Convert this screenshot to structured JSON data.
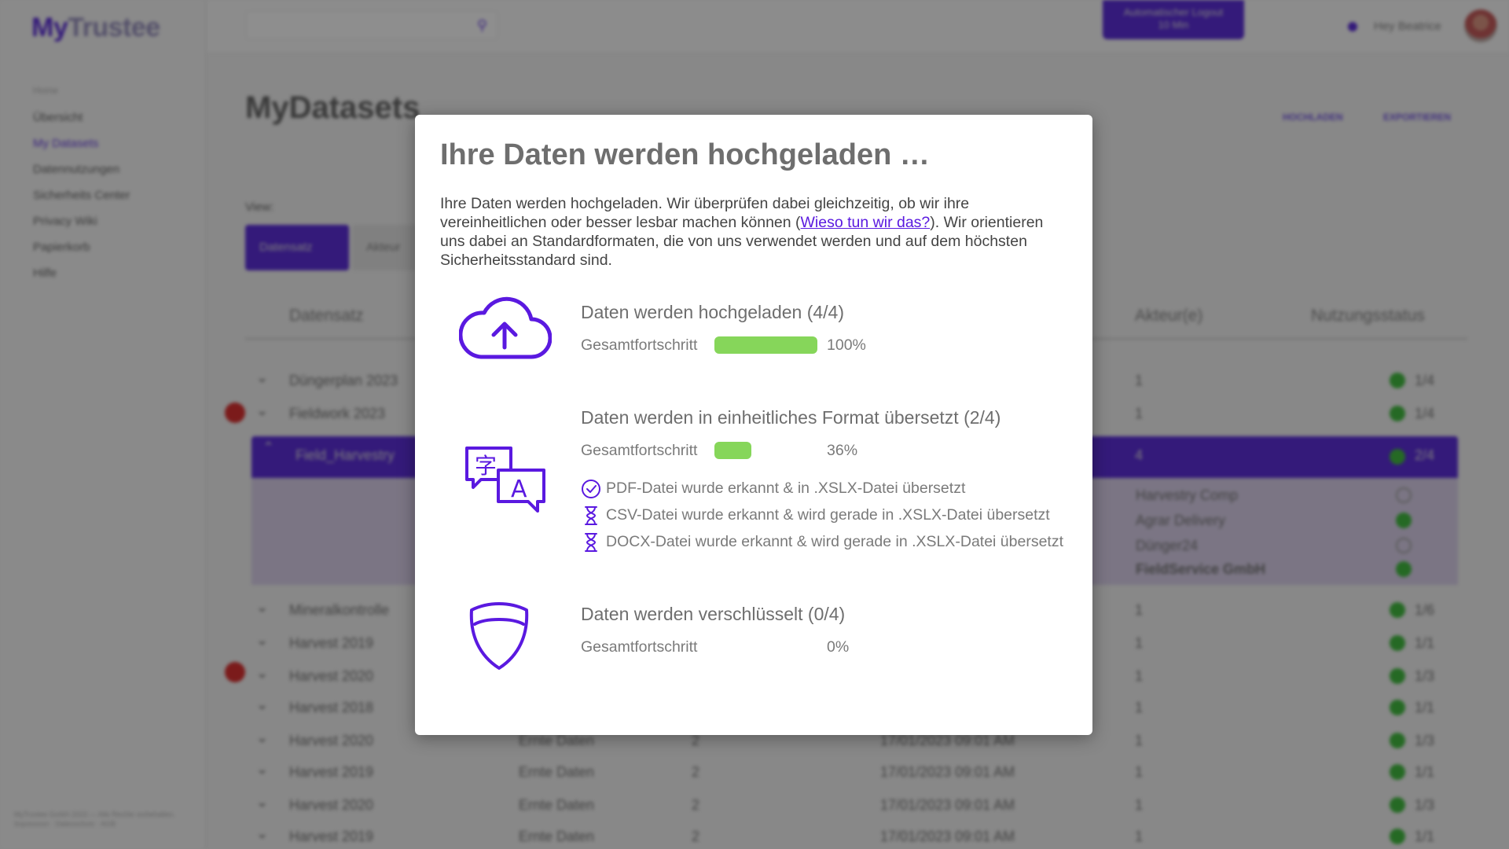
{
  "app": {
    "logo_my": "My",
    "logo_rest": "Trustee",
    "menu_head": "Home",
    "menu": [
      "Übersicht",
      "My Datasets",
      "Datennutzungen",
      "Sicherheits Center",
      "Privacy Wiki",
      "Papierkorb",
      "Hilfe"
    ],
    "footer": "MyTrustee GmbH 2023 — Alle Rechte vorbehalten. Impressum · Datenschutz · AGB",
    "logout_label": "Automatischer Logout",
    "logout_time": "10 Min",
    "greeting": "Hey Beatrice",
    "page_title": "MyDatasets",
    "hdr_upload": "HOCHLADEN",
    "hdr_export": "EXPORTIEREN",
    "view_label": "View:",
    "view_tab_active": "Datensatz",
    "view_tab_other": "Akteur",
    "col_dataset": "Datensatz",
    "col_actor": "Akteur(e)",
    "col_status": "Nutzungsstatus",
    "rows": [
      {
        "name": "Düngerplan 2023",
        "typ": "",
        "num": "",
        "date": "",
        "act": "1",
        "stat": "1/4"
      },
      {
        "name": "Fieldwork 2023",
        "typ": "",
        "num": "",
        "date": "",
        "act": "1",
        "stat": "1/4"
      },
      {
        "name": "Field_Harvestry",
        "typ": "",
        "num": "",
        "date": "",
        "act": "4",
        "stat": "2/4"
      },
      {
        "name": "Mineralkontrolle",
        "typ": "",
        "num": "",
        "date": "",
        "act": "1",
        "stat": "1/6"
      },
      {
        "name": "Harvest 2019",
        "typ": "",
        "num": "",
        "date": "",
        "act": "1",
        "stat": "1/1"
      },
      {
        "name": "Harvest 2020",
        "typ": "",
        "num": "",
        "date": "",
        "act": "1",
        "stat": "1/3"
      },
      {
        "name": "Harvest 2018",
        "typ": "",
        "num": "",
        "date": "",
        "act": "1",
        "stat": "1/1"
      },
      {
        "name": "Harvest 2020",
        "typ": "Ernte Daten",
        "num": "2",
        "date": "17/01/2023 09:01 AM",
        "act": "1",
        "stat": "1/3"
      },
      {
        "name": "Harvest 2019",
        "typ": "Ernte Daten",
        "num": "2",
        "date": "17/01/2023 09:01 AM",
        "act": "1",
        "stat": "1/1"
      },
      {
        "name": "Harvest 2020",
        "typ": "Ernte Daten",
        "num": "2",
        "date": "17/01/2023 09:01 AM",
        "act": "1",
        "stat": "1/3"
      },
      {
        "name": "Harvest 2019",
        "typ": "Ernte Daten",
        "num": "2",
        "date": "17/01/2023 09:01 AM",
        "act": "1",
        "stat": "1/1"
      }
    ],
    "sub_actors": [
      "Harvestry Comp",
      "Agrar Delivery",
      "Dünger24",
      "FieldService GmbH"
    ]
  },
  "modal": {
    "title": "Ihre Daten werden hochgeladen …",
    "intro_before": "Ihre Daten werden hochgeladen. Wir überprüfen dabei gleichzeitig, ob wir ihre vereinheitlichen oder besser lesbar machen können (",
    "intro_link": "Wieso tun wir das?",
    "intro_after": "). Wir orientieren uns dabei an Standardformaten, die von uns verwendet werden und auf dem höchsten Sicherheitsstandard sind.",
    "progress_label": "Gesamtfortschritt",
    "steps": [
      {
        "icon": "cloud-upload-icon",
        "title": "Daten werden hochgeladen (4/4)",
        "progress": 1.0,
        "pct": "100%"
      },
      {
        "icon": "translate-icon",
        "title": "Daten werden in einheitliches Format übersetzt (2/4)",
        "progress": 0.36,
        "pct": "36%"
      },
      {
        "icon": "shield-icon",
        "title": "Daten werden verschlüsselt (0/4)",
        "progress": 0.0,
        "pct": "0%"
      }
    ],
    "files": [
      {
        "icon": "check-circle-icon",
        "text": "PDF-Datei wurde erkannt & in .XSLX-Datei übersetzt"
      },
      {
        "icon": "hourglass-icon",
        "text": "CSV-Datei wurde erkannt & wird gerade in .XSLX-Datei übersetzt"
      },
      {
        "icon": "hourglass-icon",
        "text": "DOCX-Datei wurde erkannt & wird gerade in .XSLX-Datei übersetzt"
      }
    ],
    "colors": {
      "accent": "#5a19e0",
      "progress": "#86d65a"
    }
  }
}
